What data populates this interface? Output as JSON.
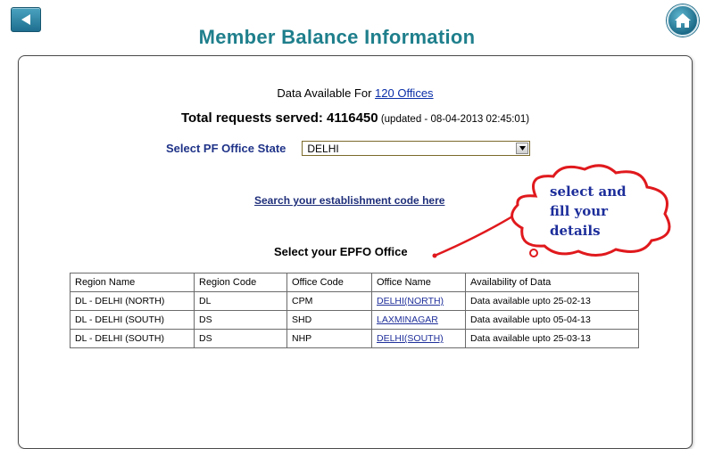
{
  "header": {
    "title": "Member Balance Information"
  },
  "summary": {
    "avail_prefix": "Data Available For ",
    "avail_link": "120 Offices",
    "total_label": "Total requests served: 4116450",
    "updated": " (updated - 08-04-2013 02:45:01)"
  },
  "state": {
    "label": "Select PF Office State",
    "selected": "DELHI"
  },
  "search_link": "Search your establishment code here",
  "office_section_title": "Select your EPFO Office",
  "table": {
    "headers": [
      "Region Name",
      "Region Code",
      "Office Code",
      "Office Name",
      "Availability of Data"
    ],
    "rows": [
      [
        "DL - DELHI (NORTH)",
        "DL",
        "CPM",
        "DELHI(NORTH)",
        "Data available upto 25-02-13"
      ],
      [
        "DL - DELHI (SOUTH)",
        "DS",
        "SHD",
        "LAXMINAGAR",
        "Data available upto 05-04-13"
      ],
      [
        "DL - DELHI (SOUTH)",
        "DS",
        "NHP",
        "DELHI(SOUTH)",
        "Data available upto 25-03-13"
      ]
    ]
  },
  "annotation": {
    "line1": "select and",
    "line2": "fill your",
    "line3": "details",
    "cloud_color": "#e0191d",
    "text_color": "#1c2d9a"
  },
  "icons": {
    "back": "back-arrow-icon",
    "home": "home-icon",
    "dropdown": "chevron-down-icon"
  },
  "colors": {
    "title": "#1f7f8c",
    "button": "#1f6f8f",
    "link": "#1f2f7a"
  }
}
